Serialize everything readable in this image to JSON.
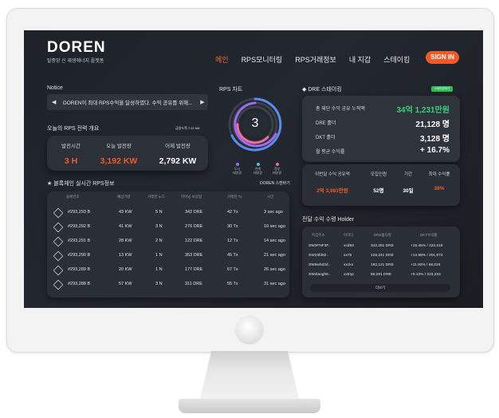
{
  "brand": {
    "title": "DOREN",
    "subtitle": "탈중앙 신 재생에너지 플랫폼"
  },
  "nav": {
    "items": [
      "메인",
      "RPS모니터링",
      "RPS거래정보",
      "내 지갑",
      "스테이킹"
    ],
    "active": "메인",
    "signin": "SIGN IN"
  },
  "notice": {
    "label": "Notice",
    "text": "DOREN이 최대 RPS수익을 달성하였다. 수익 공유를 위해..."
  },
  "rps_overview": {
    "label": "오늘의 RPS 전력 개요",
    "timestamp": "금일누적 7:12 kW",
    "columns": [
      {
        "title": "발전시간",
        "value": "3 H",
        "color": "#f05a2a"
      },
      {
        "title": "오늘 발전량",
        "value": "3,192 KW",
        "color": "#f05a2a"
      },
      {
        "title": "어제 발전량",
        "value": "2,792 KW",
        "color": "#ffffff"
      }
    ]
  },
  "rps_chart": {
    "label": "RPS 차트",
    "center_value": "3",
    "legend": [
      {
        "name": "도시\n태양광",
        "color": "#9b6cf0"
      },
      {
        "name": "연계\n태양광",
        "color": "#3ac8f0"
      },
      {
        "name": "정부\n태양광",
        "color": "#f06ea0"
      }
    ]
  },
  "blocks": {
    "label": "블록체인 실시간 RPS정보",
    "scan_link": "DOREN 스캔바기",
    "headers": [
      "블록번호",
      "예상가량",
      "거래한 노드",
      "마이닝 보상량",
      "거래한 Tx",
      "시간"
    ],
    "rows": [
      {
        "block": "#293,293 B",
        "amount": "43 KW",
        "nodes": "5 N",
        "reward": "342 DRE",
        "tx": "42 Tx",
        "time": "3 sec ago"
      },
      {
        "block": "#293,292 B",
        "amount": "41 KW",
        "nodes": "3 N",
        "reward": "276 DRE",
        "tx": "30 Tx",
        "time": "10 sec ago"
      },
      {
        "block": "#293,291 B",
        "amount": "28 KW",
        "nodes": "2 N",
        "reward": "122 DRE",
        "tx": "12 Tx",
        "time": "14 sec ago"
      },
      {
        "block": "#293,290 B",
        "amount": "13 KW",
        "nodes": "1 N",
        "reward": "353 DRE",
        "tx": "45 Tx",
        "time": "21 sec ago"
      },
      {
        "block": "#293,289 B",
        "amount": "20 KW",
        "nodes": "1 N",
        "reward": "177 DRE",
        "tx": "67 Tx",
        "time": "26 sec ago"
      },
      {
        "block": "#293,288 B",
        "amount": "57 KW",
        "nodes": "3 N",
        "reward": "311 DRE",
        "tx": "55 Tx",
        "time": "31 sec ago"
      }
    ]
  },
  "staking": {
    "label": "DRE 스테이킹",
    "badge": "스테이킹하기",
    "rows": [
      {
        "key": "총 재단 수익 공유 누적액",
        "value": "34억 1,231만원",
        "color": "#38d07a"
      },
      {
        "key": "DRE 홀더",
        "value": "21,128 명",
        "color": "#ffffff"
      },
      {
        "key": "DKT 홀더",
        "value": "3,128 명",
        "color": "#ffffff"
      },
      {
        "key": "월 평균 수익률",
        "value": "+ 16.7%",
        "color": "#ffffff"
      }
    ],
    "returns": [
      {
        "title": "이번달 수익 공유액",
        "value": "2억 3,981만원",
        "color": "#f05a2a"
      },
      {
        "title": "모집인원",
        "value": "52명",
        "color": "#ffffff"
      },
      {
        "title": "기간",
        "value": "30일",
        "color": "#ffffff"
      },
      {
        "title": "최대 수익률",
        "value": "38%",
        "color": "#f05a2a"
      }
    ]
  },
  "holders": {
    "label": "전달 수익 수령 Holder",
    "headers": [
      "지갑주소",
      "아이디",
      "DRE홀딩량",
      "DKT수익률"
    ],
    "rows": [
      {
        "address": "SW3FNF3F..",
        "id": "xxd93",
        "dre": "342,281 DRE",
        "dkt": "+15.45% / 223,318"
      },
      {
        "address": "SW23fd82..",
        "id": "xx78",
        "dre": "128,241 DRE",
        "dkt": "+12.88% / 201,974"
      },
      {
        "address": "SW6whd2d..",
        "id": "xxcko",
        "dre": "192,121 DRE",
        "dkt": "+11.92% / 68,018"
      },
      {
        "address": "SW4laogh6..",
        "id": "xx61p",
        "dre": "56,281 DRE",
        "dkt": "+9.12% / 323,234"
      }
    ],
    "more": "더보기"
  }
}
